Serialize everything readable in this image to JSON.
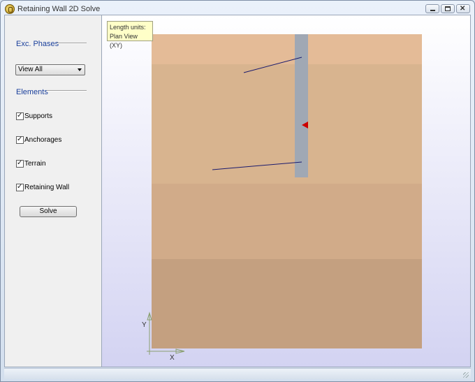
{
  "window": {
    "title": "Retaining Wall 2D Solve"
  },
  "left_panel": {
    "exc_phases_label": "Exc. Phases",
    "phase_select_value": "View All",
    "elements_label": "Elements",
    "checkboxes": [
      {
        "label": "Supports",
        "checked": true
      },
      {
        "label": "Anchorages",
        "checked": true
      },
      {
        "label": "Terrain",
        "checked": true
      },
      {
        "label": "Retaining Wall",
        "checked": true
      }
    ],
    "solve_label": "Solve"
  },
  "viewport": {
    "tooltip_line1": "Length units:",
    "tooltip_line2": "Plan  View (XY)",
    "axis_y_label": "Y",
    "axis_x_label": "X",
    "soil_layer_colors": [
      "#e4bb97",
      "#d8b48f",
      "#d1ab89",
      "#c4a080"
    ],
    "wall_color": "#a0a8b4",
    "anchor_color": "#1a1a6e",
    "support_color": "#cc0000"
  }
}
